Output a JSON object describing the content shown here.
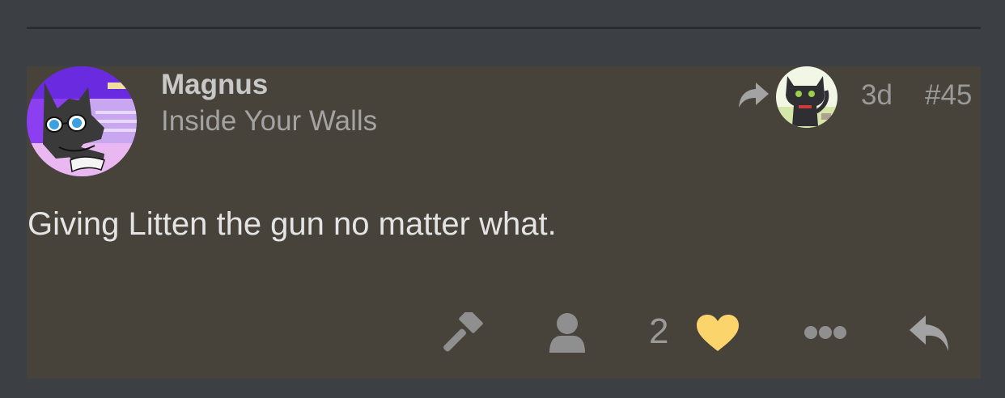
{
  "post": {
    "username": "Magnus",
    "user_title": "Inside Your Walls",
    "age": "3d",
    "post_number": "#45",
    "body": "Giving Litten the gun no matter what.",
    "like_count": "2",
    "liked": true
  },
  "icons": {
    "reply_to": "reply-arrow-icon",
    "flag": "gavel-icon",
    "user": "user-icon",
    "like": "heart-icon",
    "more": "ellipsis-icon",
    "reply": "reply-icon"
  },
  "colors": {
    "page_background": "#3c3f44",
    "post_background": "#47423a",
    "like_active": "#fbd46c",
    "muted_icon": "#8f8f8f"
  }
}
